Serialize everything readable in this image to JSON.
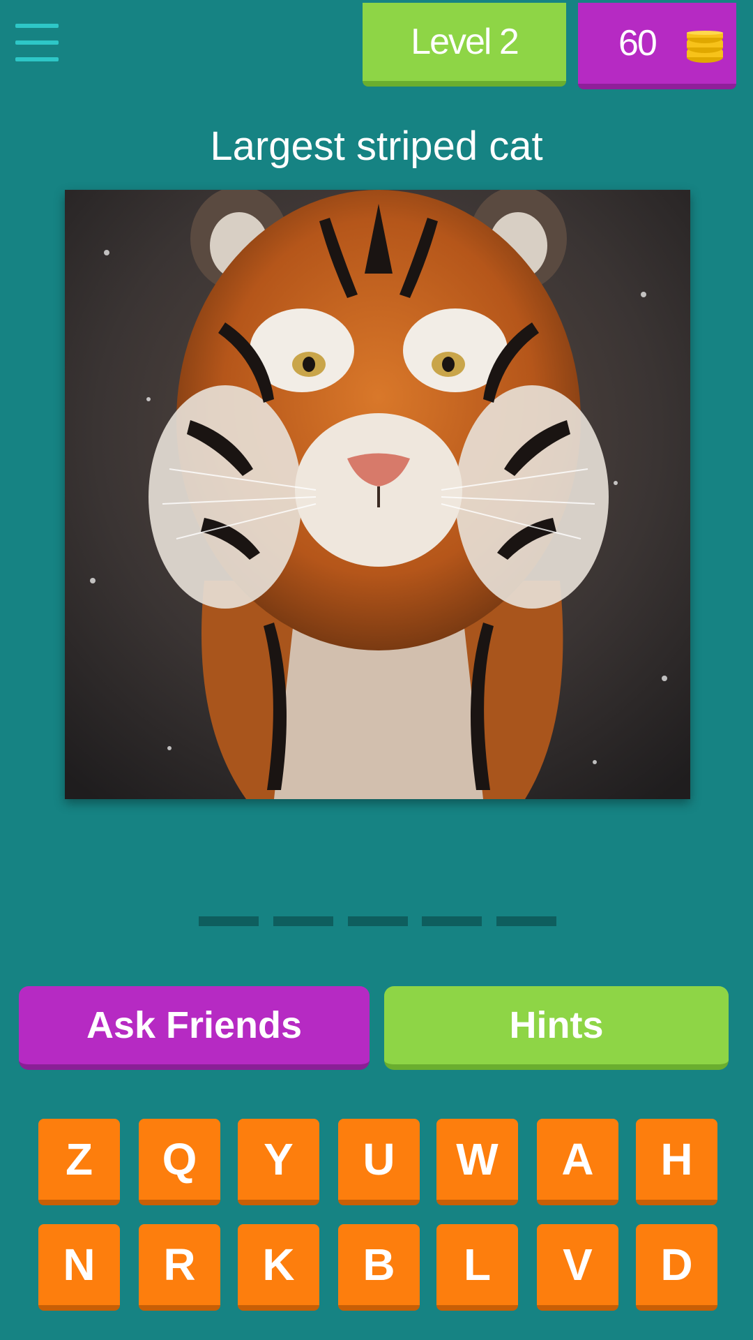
{
  "header": {
    "level_label": "Level 2",
    "coins": "60",
    "coin_icon": "coin-stack-icon",
    "menu_icon": "hamburger-menu-icon"
  },
  "question": {
    "clue": "Largest striped cat"
  },
  "image": {
    "subject": "tiger"
  },
  "answer": {
    "slot_count": 5
  },
  "actions": {
    "ask_label": "Ask Friends",
    "hints_label": "Hints"
  },
  "keyboard": {
    "row1": [
      "Z",
      "Q",
      "Y",
      "U",
      "W",
      "A",
      "H"
    ],
    "row2": [
      "N",
      "R",
      "K",
      "B",
      "L",
      "V",
      "D"
    ]
  },
  "colors": {
    "background": "#168383",
    "level_badge": "#8ed546",
    "coins_badge": "#b62ac3",
    "key": "#fd7e0d",
    "coin": "#f7c21a"
  }
}
